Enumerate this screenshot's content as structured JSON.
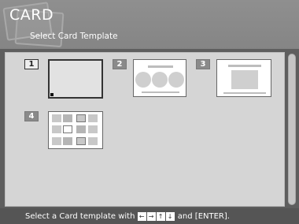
{
  "header": {
    "title": "CARD",
    "subtitle": "Select Card Template"
  },
  "templates": [
    {
      "number": "1",
      "selected": true
    },
    {
      "number": "2",
      "selected": false
    },
    {
      "number": "3",
      "selected": false
    },
    {
      "number": "4",
      "selected": false
    }
  ],
  "footer": {
    "prefix": "Select a Card template with ",
    "keys": [
      "←",
      "→",
      "↑",
      "↓"
    ],
    "suffix": " and [ENTER]."
  }
}
